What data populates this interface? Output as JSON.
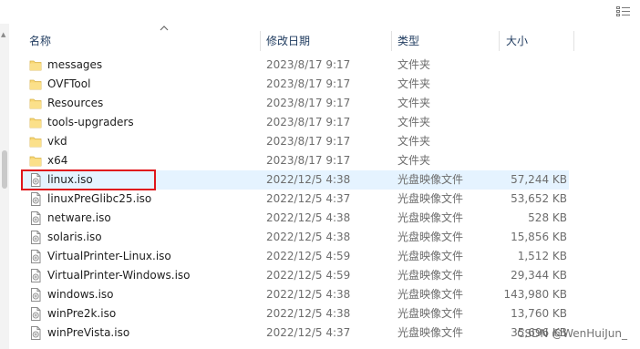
{
  "columns": {
    "name": "名称",
    "date": "修改日期",
    "type": "类型",
    "size": "大小"
  },
  "rows": [
    {
      "icon": "folder-icon",
      "name": "messages",
      "date": "2023/8/17 9:17",
      "type": "文件夹",
      "size": ""
    },
    {
      "icon": "folder-icon",
      "name": "OVFTool",
      "date": "2023/8/17 9:17",
      "type": "文件夹",
      "size": ""
    },
    {
      "icon": "folder-icon",
      "name": "Resources",
      "date": "2023/8/17 9:17",
      "type": "文件夹",
      "size": ""
    },
    {
      "icon": "folder-icon",
      "name": "tools-upgraders",
      "date": "2023/8/17 9:17",
      "type": "文件夹",
      "size": ""
    },
    {
      "icon": "folder-icon",
      "name": "vkd",
      "date": "2023/8/17 9:17",
      "type": "文件夹",
      "size": ""
    },
    {
      "icon": "folder-icon",
      "name": "x64",
      "date": "2023/8/17 9:17",
      "type": "文件夹",
      "size": ""
    },
    {
      "icon": "disc-image-icon",
      "name": "linux.iso",
      "date": "2022/12/5 4:38",
      "type": "光盘映像文件",
      "size": "57,244 KB",
      "selected": true
    },
    {
      "icon": "disc-image-icon",
      "name": "linuxPreGlibc25.iso",
      "date": "2022/12/5 4:37",
      "type": "光盘映像文件",
      "size": "53,652 KB"
    },
    {
      "icon": "disc-image-icon",
      "name": "netware.iso",
      "date": "2022/12/5 4:38",
      "type": "光盘映像文件",
      "size": "528 KB"
    },
    {
      "icon": "disc-image-icon",
      "name": "solaris.iso",
      "date": "2022/12/5 4:38",
      "type": "光盘映像文件",
      "size": "15,856 KB"
    },
    {
      "icon": "disc-image-icon",
      "name": "VirtualPrinter-Linux.iso",
      "date": "2022/12/5 4:59",
      "type": "光盘映像文件",
      "size": "1,512 KB"
    },
    {
      "icon": "disc-image-icon",
      "name": "VirtualPrinter-Windows.iso",
      "date": "2022/12/5 4:59",
      "type": "光盘映像文件",
      "size": "29,344 KB"
    },
    {
      "icon": "disc-image-icon",
      "name": "windows.iso",
      "date": "2022/12/5 4:38",
      "type": "光盘映像文件",
      "size": "143,980 KB"
    },
    {
      "icon": "disc-image-icon",
      "name": "winPre2k.iso",
      "date": "2022/12/5 4:38",
      "type": "光盘映像文件",
      "size": "13,760 KB"
    },
    {
      "icon": "disc-image-icon",
      "name": "winPreVista.iso",
      "date": "2022/12/5 4:37",
      "type": "光盘映像文件",
      "size": "35,696 KB"
    }
  ],
  "watermark": "CSDN @WenHuiJun_",
  "colors": {
    "selection": "#e5f3ff",
    "highlight_border": "#e0161c",
    "folder": "#f8d775"
  }
}
